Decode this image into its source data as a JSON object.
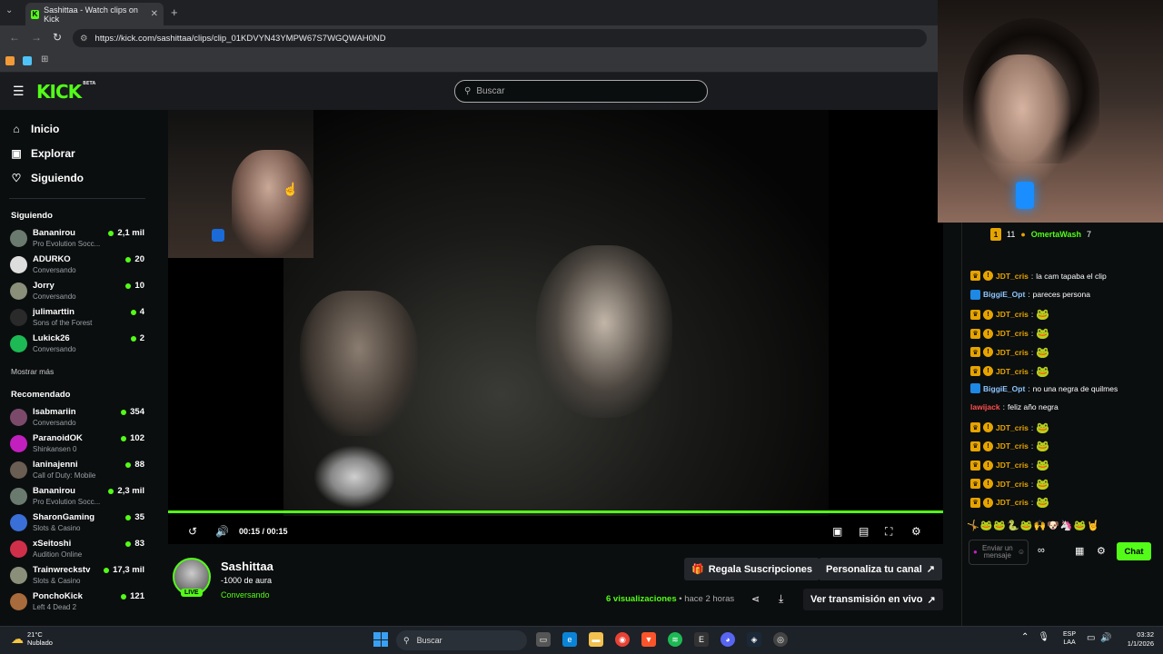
{
  "browser": {
    "tab_title": "Sashittaa - Watch clips on Kick",
    "tab_close": "✕",
    "new_tab": "+",
    "url": "https://kick.com/sashittaa/clips/clip_01KDVYN43YMPW67S7WGQWAH0ND"
  },
  "header": {
    "logo": "KICK",
    "logo_badge": "BETA",
    "search_placeholder": "Buscar"
  },
  "sidebar": {
    "nav": [
      {
        "label": "Inicio",
        "icon": "home-icon"
      },
      {
        "label": "Explorar",
        "icon": "compass-icon"
      },
      {
        "label": "Siguiendo",
        "icon": "heart-icon"
      }
    ],
    "following_title": "Siguiendo",
    "following": [
      {
        "name": "Bananirou",
        "sub": "Pro Evolution Socc...",
        "count": "2,1 mil"
      },
      {
        "name": "ADURKO",
        "sub": "Conversando",
        "count": "20"
      },
      {
        "name": "Jorry",
        "sub": "Conversando",
        "count": "10"
      },
      {
        "name": "julimarttin",
        "sub": "Sons of the Forest",
        "count": "4"
      },
      {
        "name": "Lukick26",
        "sub": "Conversando",
        "count": "2"
      }
    ],
    "show_more": "Mostrar más",
    "recommended_title": "Recomendado",
    "recommended": [
      {
        "name": "Isabmariin",
        "sub": "Conversando",
        "count": "354"
      },
      {
        "name": "ParanoidOK",
        "sub": "Shinkansen 0",
        "count": "102"
      },
      {
        "name": "laninajenni",
        "sub": "Call of Duty: Mobile",
        "count": "88"
      },
      {
        "name": "Bananirou",
        "sub": "Pro Evolution Socc...",
        "count": "2,3 mil"
      },
      {
        "name": "SharonGaming",
        "sub": "Slots & Casino",
        "count": "35"
      },
      {
        "name": "xSeitoshi",
        "sub": "Audition Online",
        "count": "83"
      },
      {
        "name": "Trainwreckstv",
        "sub": "Slots & Casino",
        "count": "17,3 mil"
      },
      {
        "name": "PonchoKick",
        "sub": "Left 4 Dead 2",
        "count": "121"
      }
    ]
  },
  "player": {
    "time": "00:15 / 00:15",
    "progress": 1.0
  },
  "clip": {
    "streamer": "Sashittaa",
    "subtitle": "-1000 de aura",
    "category": "Conversando",
    "live_badge": "LIVE",
    "gift_button": "Regala Suscripciones",
    "customize_button": "Personaliza tu canal",
    "views": "6 visualizaciones",
    "age": "• hace 2 horas",
    "watch_live": "Ver transmisión en vivo"
  },
  "chat": {
    "top_gifter_count": "11",
    "top_gifter_name": "OmertaWash",
    "top_gifter_gifts": "7",
    "messages": [
      {
        "user": "JDT_cris",
        "color": "#e6a400",
        "text": "la cam tapaba el clip",
        "badges": [
          "crown",
          "sub"
        ]
      },
      {
        "user": "BiggiE_Opt",
        "color": "#8fc6ff",
        "text": "pareces persona",
        "badges": [
          "blue"
        ]
      },
      {
        "user": "JDT_cris",
        "color": "#e6a400",
        "text": "",
        "emote": "🐸",
        "badges": [
          "crown",
          "sub"
        ]
      },
      {
        "user": "JDT_cris",
        "color": "#e6a400",
        "text": "",
        "emote": "🐸",
        "badges": [
          "crown",
          "sub"
        ]
      },
      {
        "user": "JDT_cris",
        "color": "#e6a400",
        "text": "",
        "emote": "🐸",
        "badges": [
          "crown",
          "sub"
        ]
      },
      {
        "user": "JDT_cris",
        "color": "#e6a400",
        "text": "",
        "emote": "🐸",
        "badges": [
          "crown",
          "sub"
        ]
      },
      {
        "user": "BiggiE_Opt",
        "color": "#8fc6ff",
        "text": "no una negra de quilmes",
        "badges": [
          "blue"
        ]
      },
      {
        "user": "lawijack",
        "color": "#ff4d4d",
        "text": "feliz año negra",
        "badges": []
      },
      {
        "user": "JDT_cris",
        "color": "#e6a400",
        "text": "",
        "emote": "🐸",
        "badges": [
          "crown",
          "sub"
        ]
      },
      {
        "user": "JDT_cris",
        "color": "#e6a400",
        "text": "",
        "emote": "🐸",
        "badges": [
          "crown",
          "sub"
        ]
      },
      {
        "user": "JDT_cris",
        "color": "#e6a400",
        "text": "",
        "emote": "🐸",
        "badges": [
          "crown",
          "sub"
        ]
      },
      {
        "user": "JDT_cris",
        "color": "#e6a400",
        "text": "",
        "emote": "🐸",
        "badges": [
          "crown",
          "sub"
        ]
      },
      {
        "user": "JDT_cris",
        "color": "#e6a400",
        "text": "",
        "emote": "🐸",
        "badges": [
          "crown",
          "sub"
        ]
      }
    ],
    "emote_bar": "🤸🐸🐸🐍🐸🙌🐶🦄🐸🤘",
    "input_placeholder": "Enviar un mensaje",
    "send_button": "Chat"
  },
  "taskbar": {
    "temp": "21°C",
    "weather": "Nublado",
    "search": "Buscar",
    "lang_top": "ESP",
    "lang_bottom": "LAA",
    "time": "03:32",
    "date": "1/1/2026"
  }
}
